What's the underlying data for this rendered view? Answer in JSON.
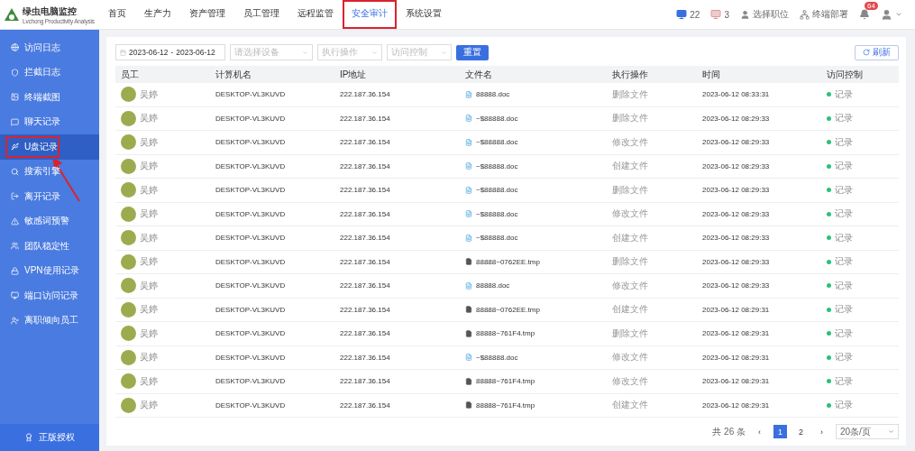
{
  "brand": {
    "name": "绿虫电脑监控",
    "tagline": "Lvchong Productivity Analysis"
  },
  "nav": [
    {
      "label": "首页",
      "selected": false,
      "highlighted": false
    },
    {
      "label": "生产力",
      "selected": false,
      "highlighted": false
    },
    {
      "label": "资产管理",
      "selected": false,
      "highlighted": false
    },
    {
      "label": "员工管理",
      "selected": false,
      "highlighted": false
    },
    {
      "label": "远程监管",
      "selected": false,
      "highlighted": false
    },
    {
      "label": "安全审计",
      "selected": true,
      "highlighted": true
    },
    {
      "label": "系统设置",
      "selected": false,
      "highlighted": false
    }
  ],
  "header_stats": {
    "online": "22",
    "offline": "3",
    "position": "选择职位",
    "deploy": "终端部署",
    "notifications": "64"
  },
  "sidebar": {
    "items": [
      {
        "label": "访问日志",
        "selected": false,
        "highlighted": false
      },
      {
        "label": "拦截日志",
        "selected": false,
        "highlighted": false
      },
      {
        "label": "终端截图",
        "selected": false,
        "highlighted": false
      },
      {
        "label": "聊天记录",
        "selected": false,
        "highlighted": false
      },
      {
        "label": "U盘记录",
        "selected": true,
        "highlighted": true
      },
      {
        "label": "搜索引擎",
        "selected": false,
        "highlighted": false
      },
      {
        "label": "离开记录",
        "selected": false,
        "highlighted": false
      },
      {
        "label": "敏感词预警",
        "selected": false,
        "highlighted": false
      },
      {
        "label": "团队稳定性",
        "selected": false,
        "highlighted": false
      },
      {
        "label": "VPN使用记录",
        "selected": false,
        "highlighted": false
      },
      {
        "label": "端口访问记录",
        "selected": false,
        "highlighted": false
      },
      {
        "label": "离职倾向员工",
        "selected": false,
        "highlighted": false
      }
    ],
    "footer": "正版授权"
  },
  "filters": {
    "date_start": "2023-06-12",
    "date_sep": "-",
    "date_end": "2023-06-12",
    "device": {
      "placeholder": "请选择设备"
    },
    "operation": {
      "placeholder": "执行操作"
    },
    "access": {
      "placeholder": "访问控制"
    },
    "reset": "重置",
    "refresh": "刷新"
  },
  "table": {
    "columns": [
      "员工",
      "计算机名",
      "IP地址",
      "文件名",
      "执行操作",
      "时间",
      "访问控制"
    ],
    "rows": [
      {
        "employee": "吴婷",
        "computer": "DESKTOP-VL3KUVD",
        "ip": "222.187.36.154",
        "file": "88888.doc",
        "kind": "doc",
        "operation": "删除文件",
        "time": "2023-06-12 08:33:31",
        "access": "记录",
        "color": "#2bbf7e"
      },
      {
        "employee": "吴婷",
        "computer": "DESKTOP-VL3KUVD",
        "ip": "222.187.36.154",
        "file": "~$88888.doc",
        "kind": "doc",
        "operation": "删除文件",
        "time": "2023-06-12 08:29:33",
        "access": "记录",
        "color": "#2bbf7e"
      },
      {
        "employee": "吴婷",
        "computer": "DESKTOP-VL3KUVD",
        "ip": "222.187.36.154",
        "file": "~$88888.doc",
        "kind": "doc",
        "operation": "修改文件",
        "time": "2023-06-12 08:29:33",
        "access": "记录",
        "color": "#2bbf7e"
      },
      {
        "employee": "吴婷",
        "computer": "DESKTOP-VL3KUVD",
        "ip": "222.187.36.154",
        "file": "~$88888.doc",
        "kind": "doc",
        "operation": "创建文件",
        "time": "2023-06-12 08:29:33",
        "access": "记录",
        "color": "#2bbf7e"
      },
      {
        "employee": "吴婷",
        "computer": "DESKTOP-VL3KUVD",
        "ip": "222.187.36.154",
        "file": "~$88888.doc",
        "kind": "doc",
        "operation": "删除文件",
        "time": "2023-06-12 08:29:33",
        "access": "记录",
        "color": "#2bbf7e"
      },
      {
        "employee": "吴婷",
        "computer": "DESKTOP-VL3KUVD",
        "ip": "222.187.36.154",
        "file": "~$88888.doc",
        "kind": "doc",
        "operation": "修改文件",
        "time": "2023-06-12 08:29:33",
        "access": "记录",
        "color": "#2bbf7e"
      },
      {
        "employee": "吴婷",
        "computer": "DESKTOP-VL3KUVD",
        "ip": "222.187.36.154",
        "file": "~$88888.doc",
        "kind": "doc",
        "operation": "创建文件",
        "time": "2023-06-12 08:29:33",
        "access": "记录",
        "color": "#2bbf7e"
      },
      {
        "employee": "吴婷",
        "computer": "DESKTOP-VL3KUVD",
        "ip": "222.187.36.154",
        "file": "88888~0762EE.tmp",
        "kind": "tmp",
        "operation": "删除文件",
        "time": "2023-06-12 08:29:33",
        "access": "记录",
        "color": "#2bbf7e"
      },
      {
        "employee": "吴婷",
        "computer": "DESKTOP-VL3KUVD",
        "ip": "222.187.36.154",
        "file": "88888.doc",
        "kind": "doc",
        "operation": "修改文件",
        "time": "2023-06-12 08:29:33",
        "access": "记录",
        "color": "#2bbf7e"
      },
      {
        "employee": "吴婷",
        "computer": "DESKTOP-VL3KUVD",
        "ip": "222.187.36.154",
        "file": "88888~0762EE.tmp",
        "kind": "tmp",
        "operation": "创建文件",
        "time": "2023-06-12 08:29:31",
        "access": "记录",
        "color": "#2bbf7e"
      },
      {
        "employee": "吴婷",
        "computer": "DESKTOP-VL3KUVD",
        "ip": "222.187.36.154",
        "file": "88888~761F4.tmp",
        "kind": "tmp",
        "operation": "删除文件",
        "time": "2023-06-12 08:29:31",
        "access": "记录",
        "color": "#2bbf7e"
      },
      {
        "employee": "吴婷",
        "computer": "DESKTOP-VL3KUVD",
        "ip": "222.187.36.154",
        "file": "~$88888.doc",
        "kind": "doc",
        "operation": "修改文件",
        "time": "2023-06-12 08:29:31",
        "access": "记录",
        "color": "#2bbf7e"
      },
      {
        "employee": "吴婷",
        "computer": "DESKTOP-VL3KUVD",
        "ip": "222.187.36.154",
        "file": "88888~761F4.tmp",
        "kind": "tmp",
        "operation": "修改文件",
        "time": "2023-06-12 08:29:31",
        "access": "记录",
        "color": "#2bbf7e"
      },
      {
        "employee": "吴婷",
        "computer": "DESKTOP-VL3KUVD",
        "ip": "222.187.36.154",
        "file": "88888~761F4.tmp",
        "kind": "tmp",
        "operation": "创建文件",
        "time": "2023-06-12 08:29:31",
        "access": "记录",
        "color": "#2bbf7e"
      }
    ]
  },
  "pagination": {
    "total": "共 26 条",
    "prev": "‹",
    "pages": [
      {
        "label": "1",
        "selected": true
      },
      {
        "label": "2",
        "selected": false
      }
    ],
    "next": "›",
    "page_size": "20条/页"
  }
}
